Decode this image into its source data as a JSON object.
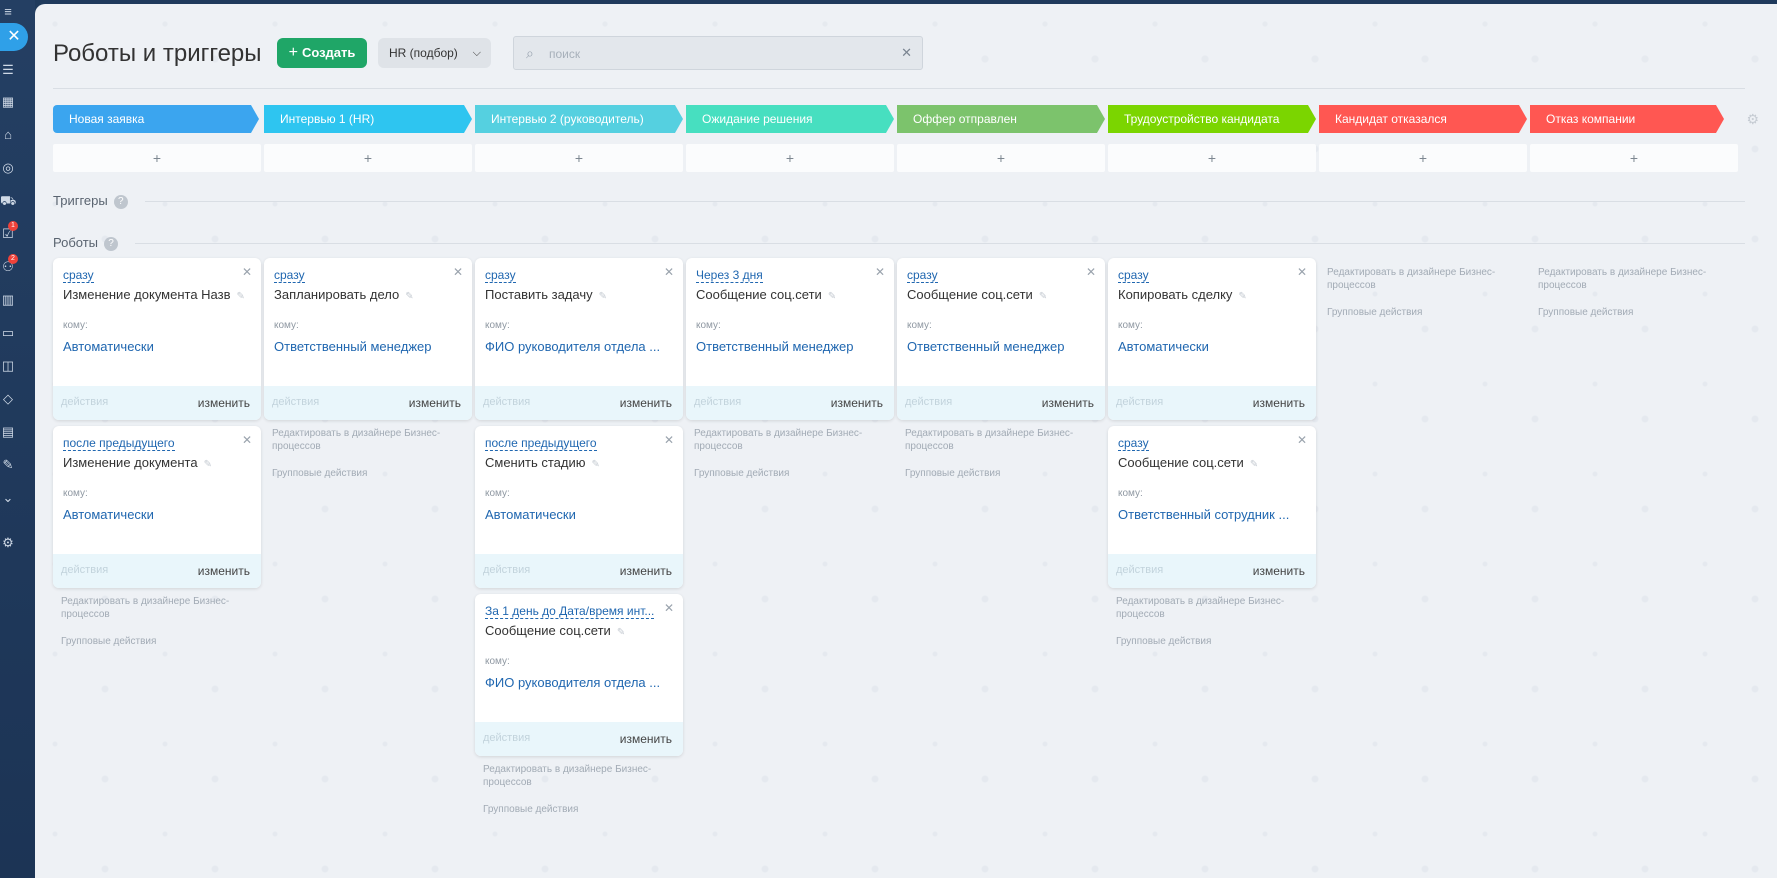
{
  "title": "Роботы и триггеры",
  "create_label": "Создать",
  "pipeline_label": "HR (подбор)",
  "search_placeholder": "поиск",
  "add_label": "+",
  "triggers_label": "Триггеры",
  "robots_label": "Роботы",
  "to_label": "кому:",
  "actions_label": "действия",
  "edit_label": "изменить",
  "designer_label": "Редактировать в дизайнере Бизнес-процессов",
  "group_label": "Групповые действия",
  "rail_badges": [
    "1",
    "2"
  ],
  "stages": [
    {
      "name": "Новая заявка",
      "color": "#3ba5ef"
    },
    {
      "name": "Интервью 1 (HR)",
      "color": "#2ec5f0"
    },
    {
      "name": "Интервью 2 (руководитель)",
      "color": "#55d0e0"
    },
    {
      "name": "Ожидание решения",
      "color": "#47dfc0"
    },
    {
      "name": "Оффер отправлен",
      "color": "#7cc36c"
    },
    {
      "name": "Трудоустройство кандидата",
      "color": "#7bd500"
    },
    {
      "name": "Кандидат отказался",
      "color": "#ff5752"
    },
    {
      "name": "Отказ компании",
      "color": "#ff5752"
    }
  ],
  "robots": [
    [
      {
        "when": "сразу",
        "name": "Изменение документа Назв",
        "who": "Автоматически"
      },
      {
        "when": "после предыдущего",
        "name": "Изменение документа",
        "who": "Автоматически"
      }
    ],
    [
      {
        "when": "сразу",
        "name": "Запланировать дело",
        "who": "Ответственный менеджер"
      }
    ],
    [
      {
        "when": "сразу",
        "name": "Поставить задачу",
        "who": "ФИО руководителя отдела ..."
      },
      {
        "when": "после предыдущего",
        "name": "Сменить стадию",
        "who": "Автоматически"
      },
      {
        "when": "За 1 день до Дата/время инт...",
        "name": "Сообщение соц.сети",
        "who": "ФИО руководителя отдела ..."
      }
    ],
    [
      {
        "when": "Через 3 дня",
        "name": "Сообщение соц.сети",
        "who": "Ответственный менеджер"
      }
    ],
    [
      {
        "when": "сразу",
        "name": "Сообщение соц.сети",
        "who": "Ответственный менеджер"
      }
    ],
    [
      {
        "when": "сразу",
        "name": "Копировать сделку",
        "who": "Автоматически"
      },
      {
        "when": "сразу",
        "name": "Сообщение соц.сети",
        "who": "Ответственный сотрудник ..."
      }
    ],
    [],
    []
  ]
}
